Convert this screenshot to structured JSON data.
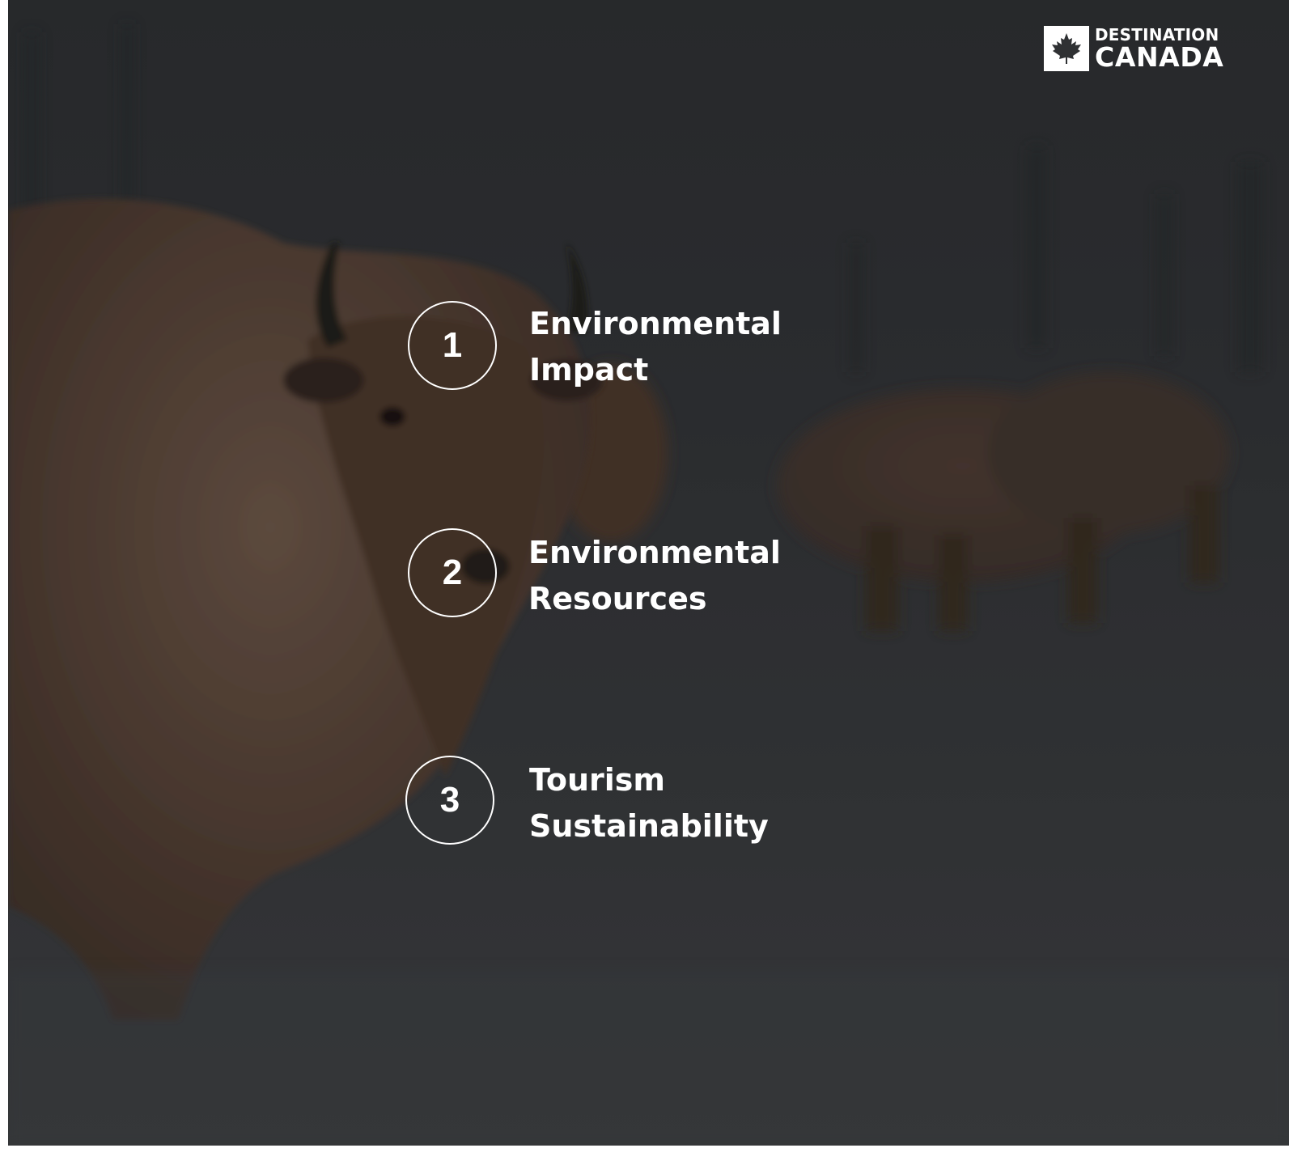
{
  "brand": {
    "line1": "DESTINATION",
    "line2": "CANADA",
    "icon": "maple-leaf-icon"
  },
  "agenda": [
    {
      "number": "1",
      "line1": "Environmental",
      "line2": "Impact"
    },
    {
      "number": "2",
      "line1": "Environmental",
      "line2": "Resources"
    },
    {
      "number": "3",
      "line1": "Tourism",
      "line2": "Sustainability"
    }
  ],
  "colors": {
    "text": "#ffffff",
    "background": "#2f3133"
  }
}
